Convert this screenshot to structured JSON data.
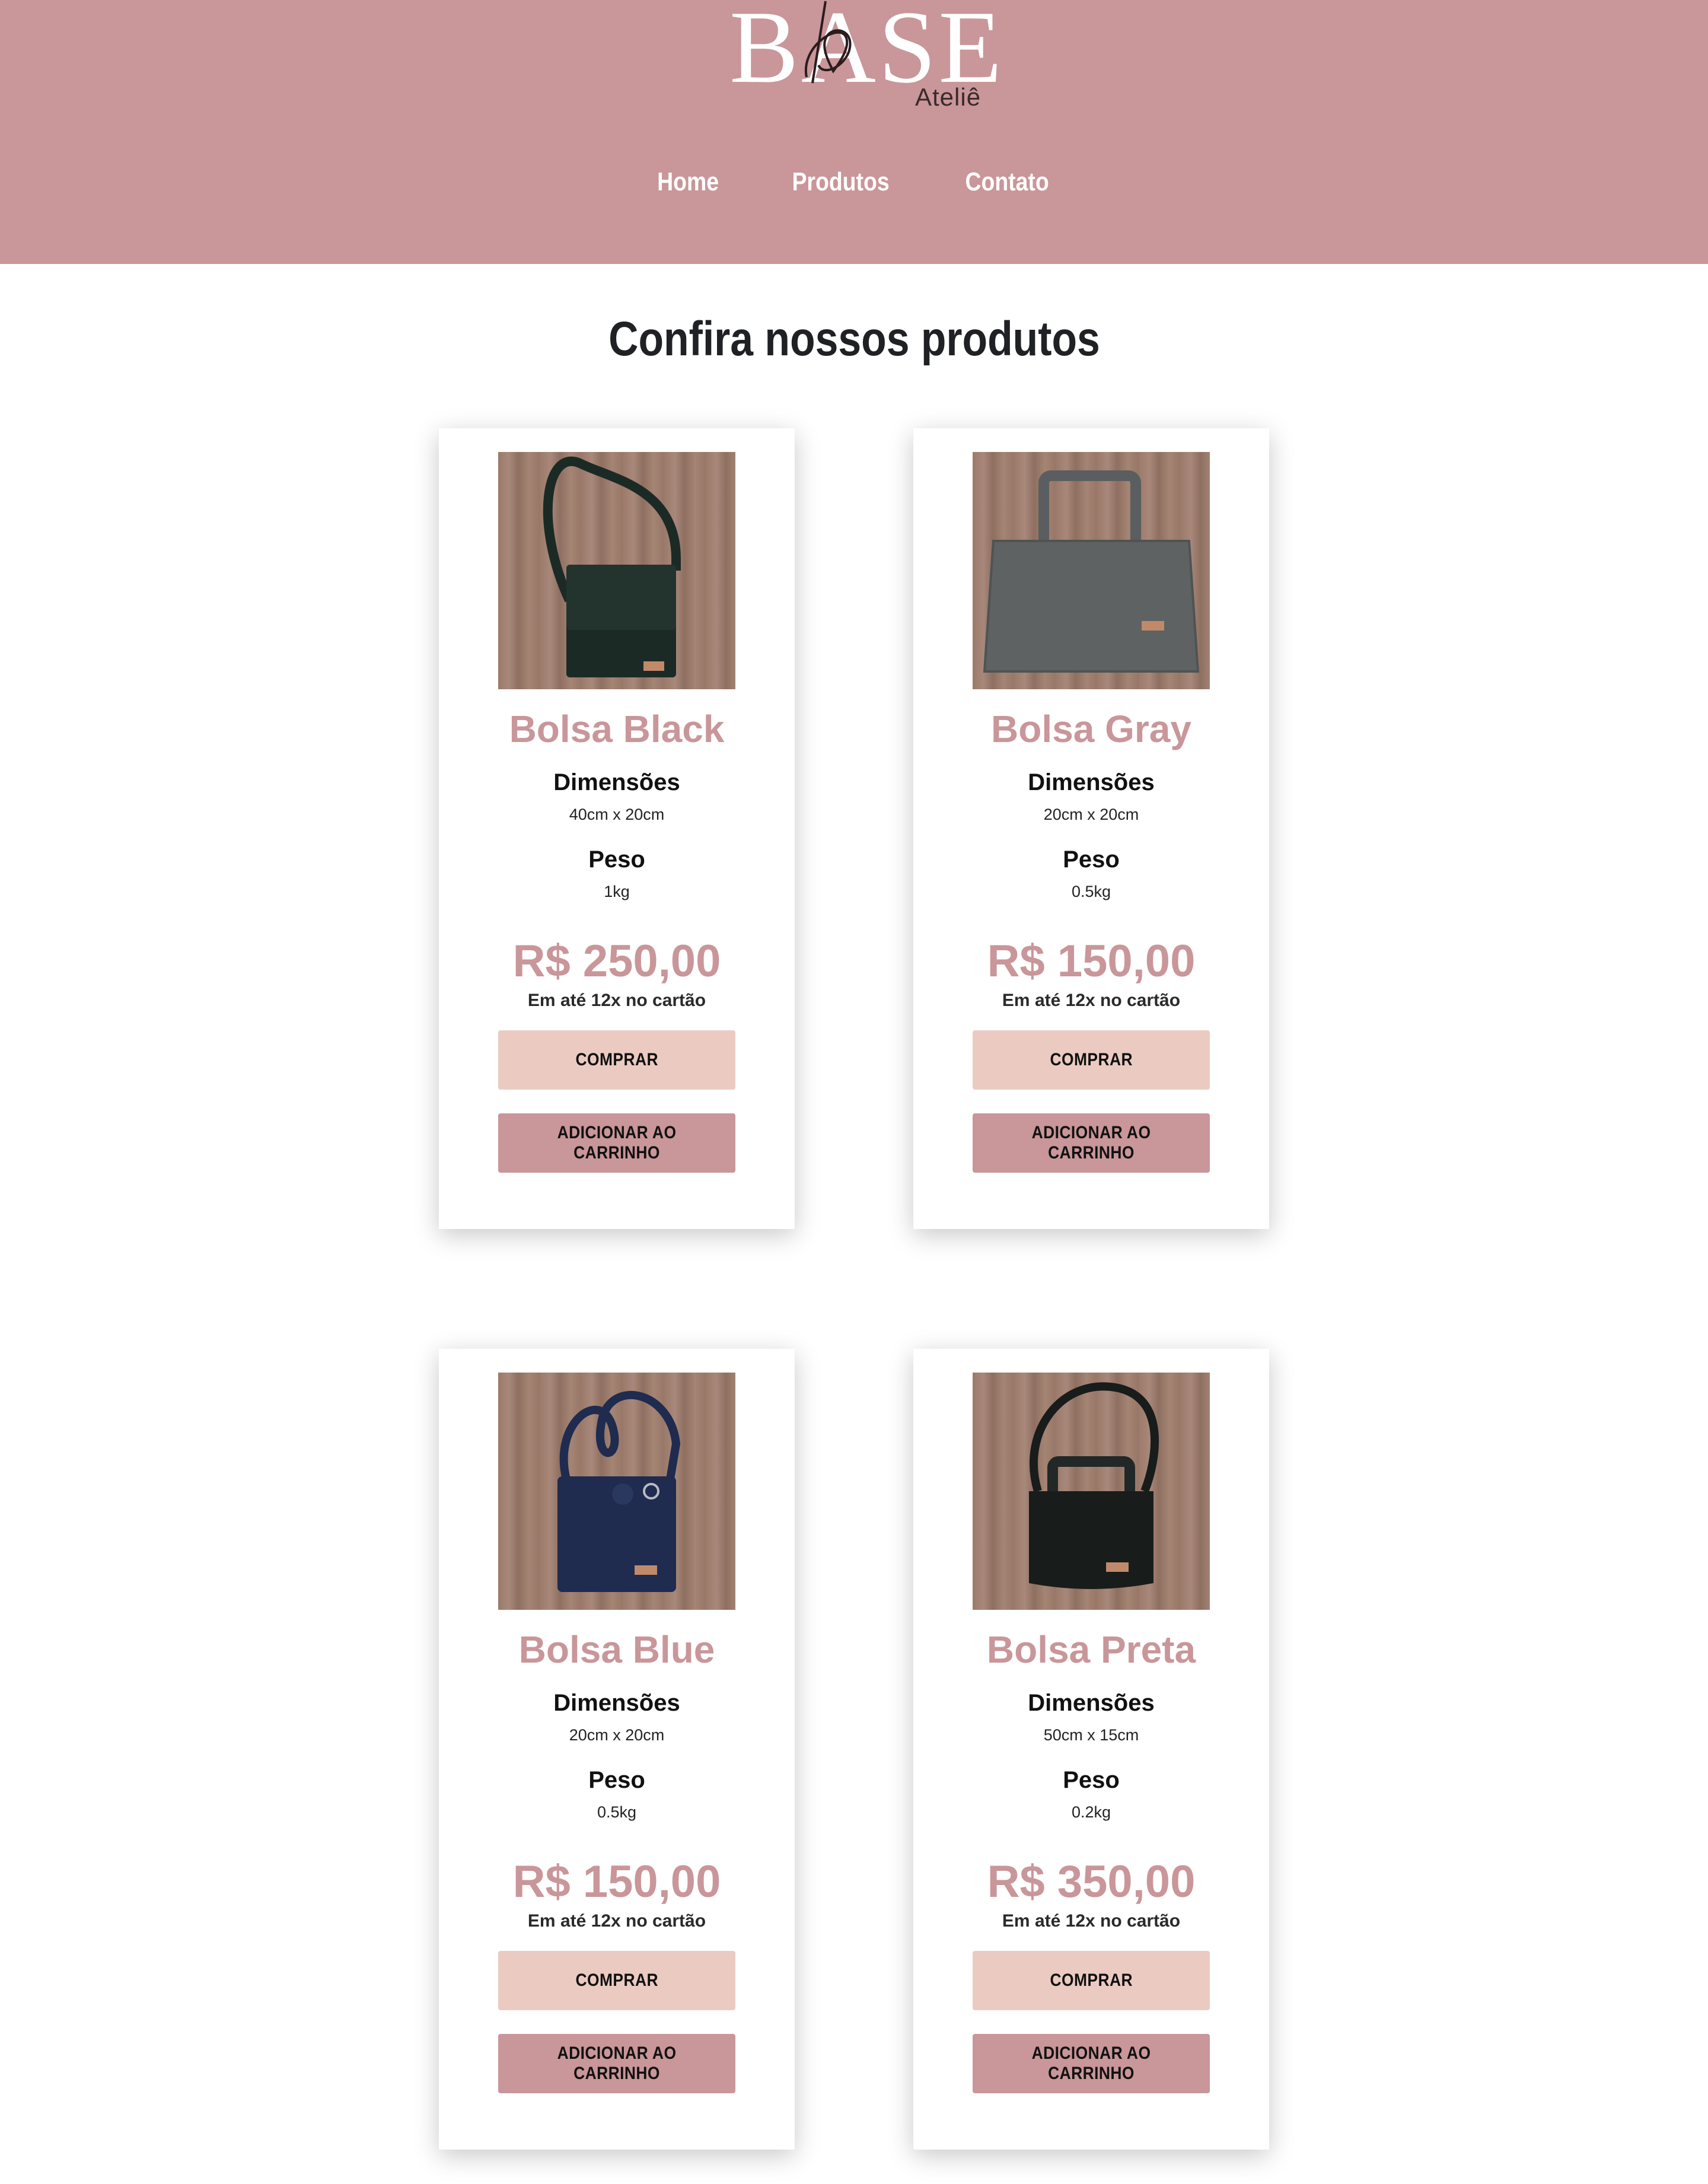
{
  "brand": {
    "name": "BASE",
    "subtitle": "Ateliê"
  },
  "nav": {
    "items": [
      "Home",
      "Produtos",
      "Contato"
    ]
  },
  "main": {
    "title": "Confira nossos produtos"
  },
  "colors": {
    "header_bg": "#c99699",
    "accent": "#c99699",
    "buy_button": "#ebcbc1",
    "cart_button": "#c99699"
  },
  "products": [
    {
      "name": "Bolsa Black",
      "dimensions_label": "Dimensões",
      "dimensions": "40cm x 20cm",
      "weight_label": "Peso",
      "weight": "1kg",
      "price": "R$ 250,00",
      "installments": "Em até 12x no cartão",
      "buy_label": "COMPRAR",
      "cart_label": "ADICIONAR AO CARRINHO",
      "bag_color": "#1c2a26"
    },
    {
      "name": "Bolsa Gray",
      "dimensions_label": "Dimensões",
      "dimensions": "20cm x 20cm",
      "weight_label": "Peso",
      "weight": "0.5kg",
      "price": "R$ 150,00",
      "installments": "Em até 12x no cartão",
      "buy_label": "COMPRAR",
      "cart_label": "ADICIONAR AO CARRINHO",
      "bag_color": "#5e6263"
    },
    {
      "name": "Bolsa Blue",
      "dimensions_label": "Dimensões",
      "dimensions": "20cm x 20cm",
      "weight_label": "Peso",
      "weight": "0.5kg",
      "price": "R$ 150,00",
      "installments": "Em até 12x no cartão",
      "buy_label": "COMPRAR",
      "cart_label": "ADICIONAR AO CARRINHO",
      "bag_color": "#1f2b4f"
    },
    {
      "name": "Bolsa Preta",
      "dimensions_label": "Dimensões",
      "dimensions": "50cm x 15cm",
      "weight_label": "Peso",
      "weight": "0.2kg",
      "price": "R$ 350,00",
      "installments": "Em até 12x no cartão",
      "buy_label": "COMPRAR",
      "cart_label": "ADICIONAR AO CARRINHO",
      "bag_color": "#181c1b"
    }
  ]
}
